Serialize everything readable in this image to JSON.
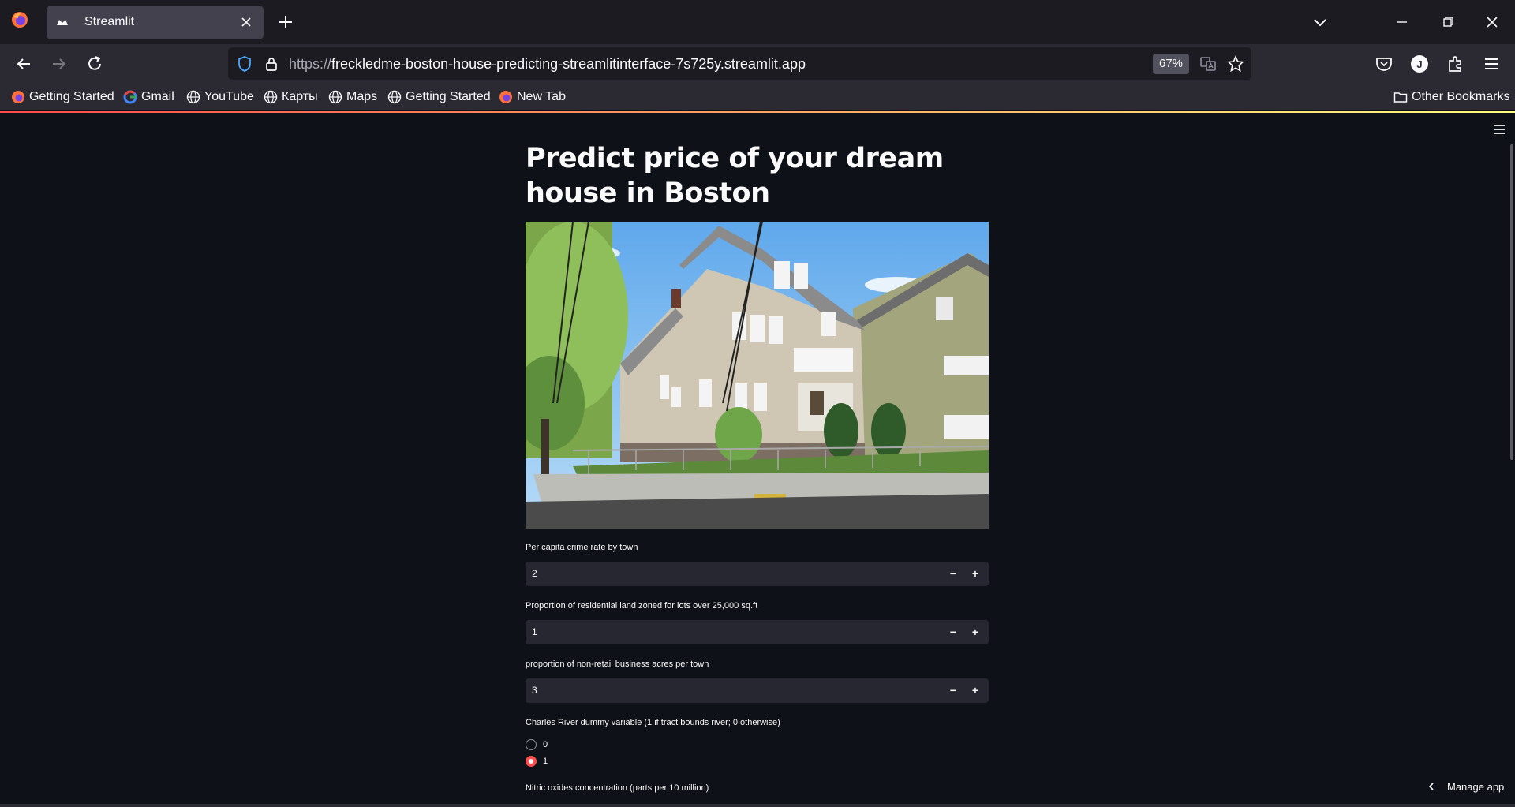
{
  "browser": {
    "tab_title": "Streamlit",
    "url_protocol": "https://",
    "url_host": "freckledme-boston-house-predicting-streamlitinterface-7s725y.streamlit.app",
    "zoom": "67%",
    "bookmarks": [
      {
        "label": "Getting Started",
        "icon": "firefox-icon"
      },
      {
        "label": "Gmail",
        "icon": "google-icon"
      },
      {
        "label": "YouTube",
        "icon": "globe-icon"
      },
      {
        "label": "Карты",
        "icon": "globe-icon"
      },
      {
        "label": "Maps",
        "icon": "globe-icon"
      },
      {
        "label": "Getting Started",
        "icon": "globe-icon"
      },
      {
        "label": "New Tab",
        "icon": "firefox-icon"
      }
    ],
    "other_bookmarks": "Other Bookmarks",
    "profile_initial": "J"
  },
  "app": {
    "title": "Predict price of your dream house in Boston",
    "fields": [
      {
        "label": "Per capita crime rate by town",
        "value": "2"
      },
      {
        "label": "Proportion of residential land zoned for lots over 25,000 sq.ft",
        "value": "1"
      },
      {
        "label": "proportion of non-retail business acres per town",
        "value": "3"
      }
    ],
    "radio_group": {
      "label": "Charles River dummy variable (1 if tract bounds river; 0 otherwise)",
      "options": [
        "0",
        "1"
      ],
      "selected": "1"
    },
    "next_label": "Nitric oxides concentration (parts per 10 million)",
    "stepper_minus": "−",
    "stepper_plus": "+",
    "manage_app": "Manage app"
  },
  "colors": {
    "accent": "#ff4b4b",
    "app_bg": "#0e1117",
    "input_bg": "#262730"
  }
}
